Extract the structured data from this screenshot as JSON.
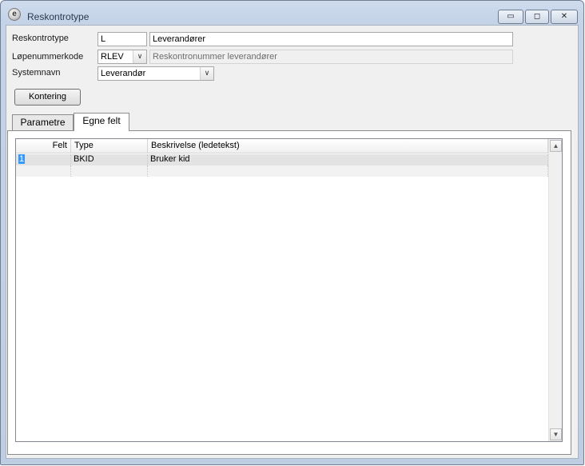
{
  "window": {
    "title": "Reskontrotype",
    "icon": "e-logo-icon",
    "controls": {
      "minimize": "▭",
      "maximize": "◻",
      "close": "✕"
    }
  },
  "form": {
    "reskontrotype": {
      "label": "Reskontrotype",
      "code": "L",
      "name": "Leverandører"
    },
    "lopenummerkode": {
      "label": "Løpenummerkode",
      "code": "RLEV",
      "description": "Reskontronummer leverandører"
    },
    "systemnavn": {
      "label": "Systemnavn",
      "value": "Leverandør"
    }
  },
  "buttons": {
    "kontering": "Kontering"
  },
  "tabs": [
    {
      "label": "Parametre",
      "active": false
    },
    {
      "label": "Egne felt",
      "active": true
    }
  ],
  "grid": {
    "columns": [
      "Felt",
      "Type",
      "Beskrivelse (ledetekst)"
    ],
    "rows": [
      {
        "felt": "1",
        "type": "BKID",
        "beskrivelse": "Bruker kid"
      },
      {
        "felt": "",
        "type": "",
        "beskrivelse": ""
      }
    ]
  }
}
